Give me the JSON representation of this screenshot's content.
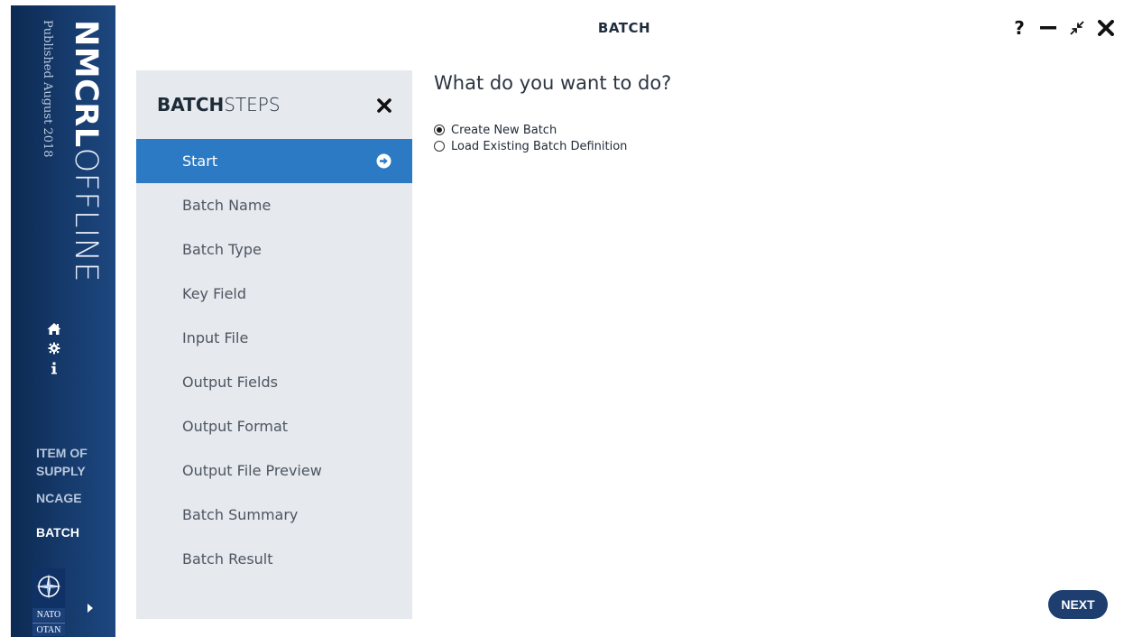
{
  "app": {
    "brand_bold": "NMCRL",
    "brand_light": "OFFLINE",
    "published": "Published August 2018",
    "window_title": "BATCH"
  },
  "sidebar": {
    "icons": [
      "home-icon",
      "gear-icon",
      "info-icon"
    ],
    "nav": [
      {
        "label_line1": "ITEM OF",
        "label_line2": "SUPPLY",
        "active": false
      },
      {
        "label": "NCAGE",
        "active": false
      },
      {
        "label": "BATCH",
        "active": true
      }
    ],
    "logo_text_top": "NATO",
    "logo_text_bottom": "OTAN"
  },
  "window_controls": {
    "help": "?",
    "minimize": "minimize-icon",
    "restore": "restore-icon",
    "close": "close-icon"
  },
  "steps_panel": {
    "title_bold": "BATCH",
    "title_light": "STEPS",
    "steps": [
      {
        "label": "Start",
        "active": true
      },
      {
        "label": "Batch Name",
        "active": false
      },
      {
        "label": "Batch Type",
        "active": false
      },
      {
        "label": "Key Field",
        "active": false
      },
      {
        "label": "Input File",
        "active": false
      },
      {
        "label": "Output Fields",
        "active": false
      },
      {
        "label": "Output Format",
        "active": false
      },
      {
        "label": "Output File Preview",
        "active": false
      },
      {
        "label": "Batch Summary",
        "active": false
      },
      {
        "label": "Batch Result",
        "active": false
      }
    ]
  },
  "main": {
    "question": "What do you want to do?",
    "options": [
      {
        "label": "Create New Batch",
        "selected": true
      },
      {
        "label": "Load Existing Batch Definition",
        "selected": false
      }
    ],
    "next_label": "NEXT"
  },
  "colors": {
    "sidebar": "#163b6d",
    "active_step": "#2c7ac3",
    "panel": "#e6e9ed",
    "next_button": "#1d3e6f"
  }
}
